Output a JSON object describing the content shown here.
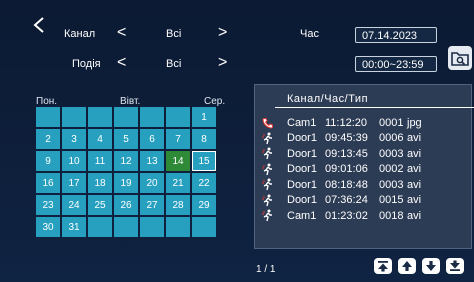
{
  "filters": {
    "channel_label": "Канал",
    "channel_value": "Всі",
    "event_label": "Подія",
    "event_value": "Всі",
    "time_label": "Час",
    "date_value": "07.14.2023",
    "time_range_value": "00:00~23:59"
  },
  "calendar": {
    "weekday_mon": "Пон.",
    "weekday_wed": "Вівт.",
    "weekday_sun": "Сер.",
    "rows": [
      [
        "",
        "",
        "",
        "",
        "",
        "",
        "1"
      ],
      [
        "2",
        "3",
        "4",
        "5",
        "6",
        "7",
        "8"
      ],
      [
        "9",
        "10",
        "11",
        "12",
        "13",
        "14",
        "15"
      ],
      [
        "16",
        "17",
        "18",
        "19",
        "20",
        "21",
        "22"
      ],
      [
        "23",
        "24",
        "25",
        "26",
        "27",
        "28",
        "29"
      ],
      [
        "30",
        "31",
        "",
        "",
        "",
        "",
        ""
      ]
    ],
    "highlighted_day": "14",
    "selected_day": "15"
  },
  "records": {
    "header": "Канал/Час/Тип",
    "items": [
      {
        "icon": "phone-icon",
        "channel": "Cam1",
        "time": "11:12:20",
        "number": "0001",
        "type": "jpg"
      },
      {
        "icon": "motion-icon",
        "channel": "Door1",
        "time": "09:45:39",
        "number": "0006",
        "type": "avi"
      },
      {
        "icon": "motion-icon",
        "channel": "Door1",
        "time": "09:13:45",
        "number": "0003",
        "type": "avi"
      },
      {
        "icon": "motion-icon",
        "channel": "Door1",
        "time": "09:01:06",
        "number": "0002",
        "type": "avi"
      },
      {
        "icon": "motion-icon",
        "channel": "Door1",
        "time": "08:18:48",
        "number": "0003",
        "type": "avi"
      },
      {
        "icon": "motion-icon",
        "channel": "Door1",
        "time": "07:36:24",
        "number": "0015",
        "type": "avi"
      },
      {
        "icon": "motion-icon",
        "channel": "Cam1",
        "time": "01:23:02",
        "number": "0018",
        "type": "avi"
      }
    ]
  },
  "pager": "1 / 1",
  "colors": {
    "calendar_cell": "#27a0c0",
    "today_cell": "#2e8a36",
    "icon_red": "#e53935"
  }
}
